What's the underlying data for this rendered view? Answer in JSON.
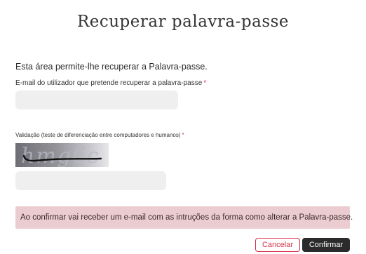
{
  "page": {
    "title": "Recuperar palavra-passe",
    "intro": "Esta área permite-lhe recuperar a Palavra-passe."
  },
  "form": {
    "email_label": "E-mail do utilizador que pretende recuperar a palavra-passe",
    "email_value": "",
    "email_placeholder": "",
    "required_marker": "*",
    "captcha_label": "Validação (teste de diferenciação entre computadores e humanos)",
    "captcha_image_text": "hmg6c",
    "captcha_value": "",
    "captcha_placeholder": ""
  },
  "notice": {
    "text": "Ao confirmar vai receber um e-mail com as intruções da forma como alterar a Palavra-passe."
  },
  "actions": {
    "cancel_label": "Cancelar",
    "confirm_label": "Confirmar"
  },
  "colors": {
    "accent": "#d6334a",
    "notice_bg": "#ebcdd1",
    "input_bg": "#efefef",
    "confirm_bg": "#2b2b2b"
  }
}
